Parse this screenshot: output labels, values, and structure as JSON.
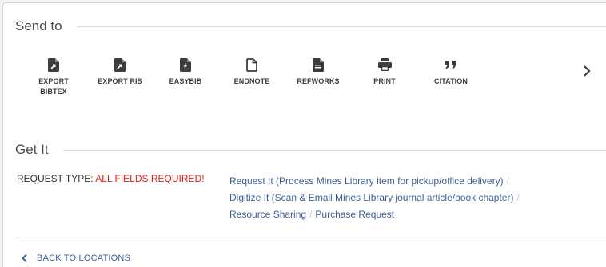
{
  "send_to": {
    "title": "Send to",
    "actions": [
      {
        "id": "export-bibtex",
        "label": "EXPORT\nBIBTEX",
        "icon": "export-file-icon"
      },
      {
        "id": "export-ris",
        "label": "EXPORT RIS",
        "icon": "export-file-icon"
      },
      {
        "id": "easybib",
        "label": "EASYBIB",
        "icon": "easybib-file-icon"
      },
      {
        "id": "endnote",
        "label": "ENDNOTE",
        "icon": "outline-file-icon"
      },
      {
        "id": "refworks",
        "label": "REFWORKS",
        "icon": "lined-file-icon"
      },
      {
        "id": "print",
        "label": "PRINT",
        "icon": "printer-icon"
      },
      {
        "id": "citation",
        "label": "CITATION",
        "icon": "quote-icon"
      }
    ],
    "next_icon": "chevron-right-icon"
  },
  "get_it": {
    "title": "Get It",
    "request_type_label": "REQUEST TYPE:",
    "required_text": "ALL FIELDS REQUIRED!",
    "links": [
      "Request It (Process Mines Library item for pickup/office delivery)",
      "Digitize It (Scan & Email Mines Library journal article/book chapter)",
      "Resource Sharing",
      "Purchase Request"
    ],
    "separator": "/"
  },
  "back": {
    "label": "BACK TO LOCATIONS",
    "icon": "chevron-left-icon"
  },
  "colors": {
    "link": "#3b5f94",
    "required": "#e0201b",
    "text": "#333333",
    "icon": "#3d3d3d"
  }
}
